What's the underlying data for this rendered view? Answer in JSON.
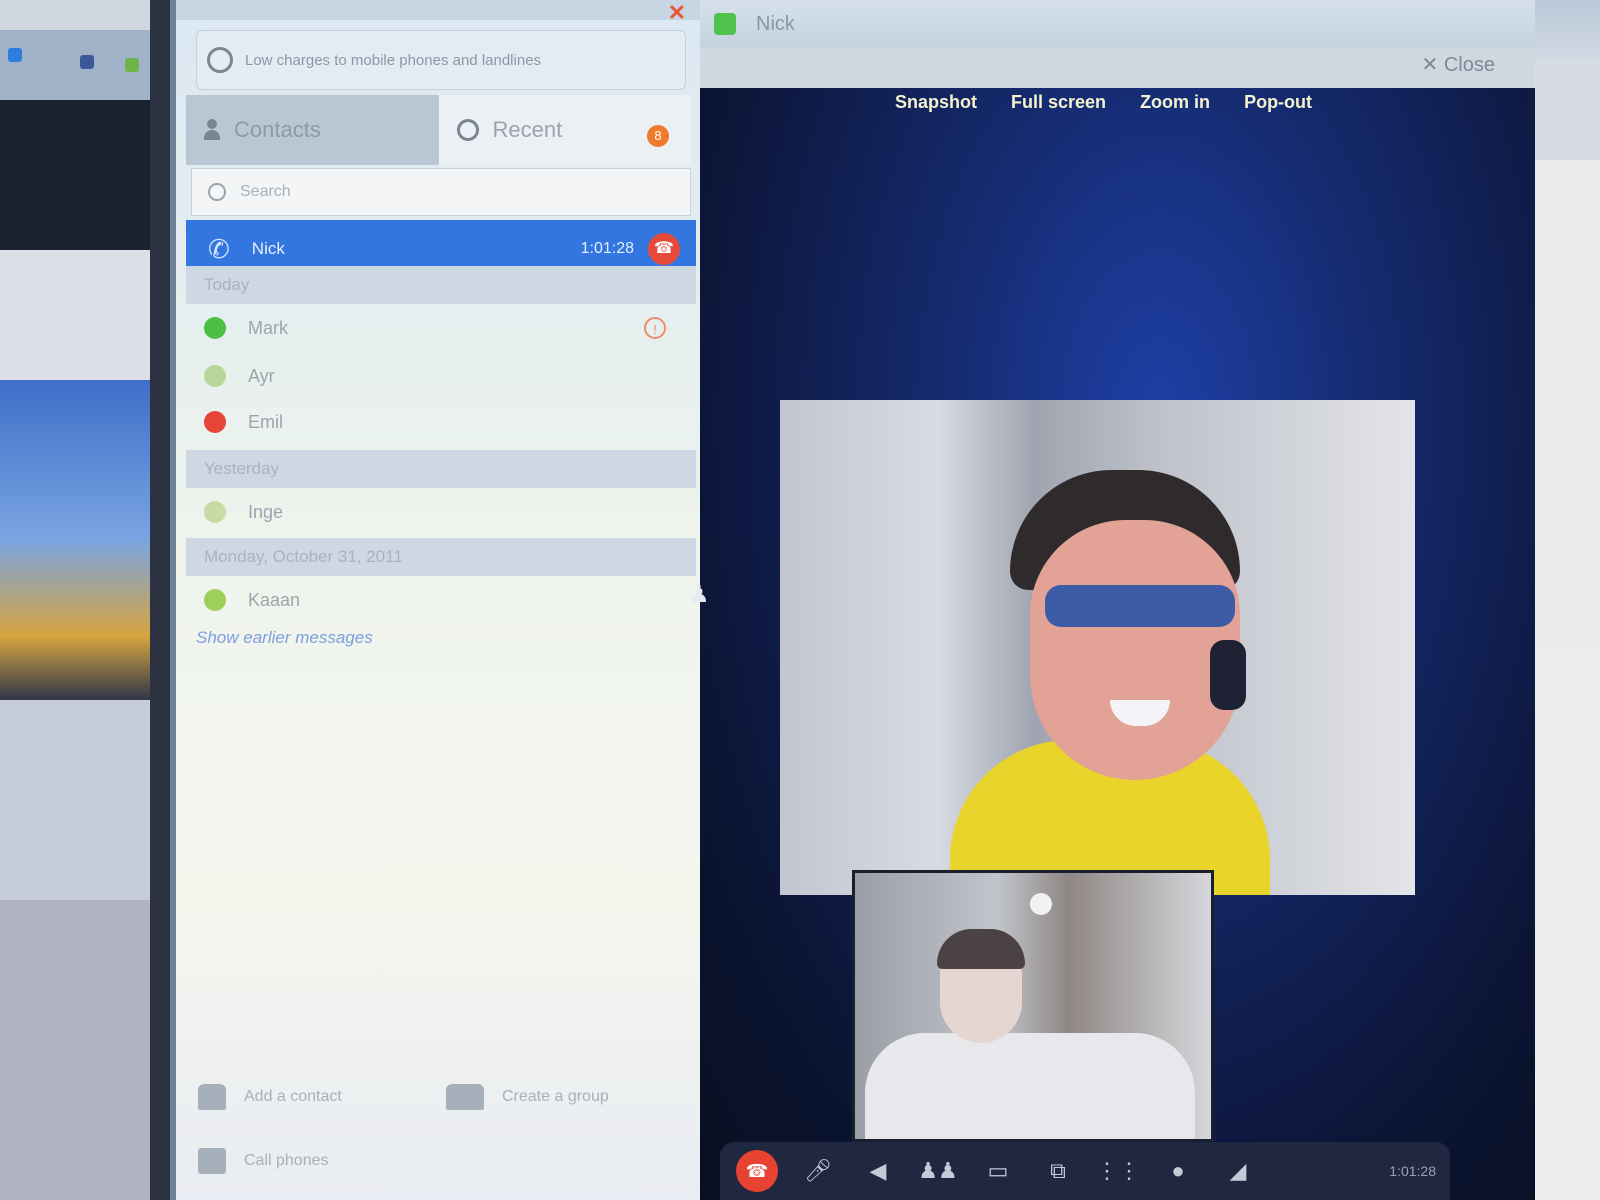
{
  "promo": {
    "text": "Low charges to mobile phones and landlines"
  },
  "tabs": {
    "contacts": "Contacts",
    "recent": "Recent",
    "recent_badge": "8"
  },
  "search": {
    "placeholder": "Search"
  },
  "active_call": {
    "name": "Nick",
    "duration": "1:01:28"
  },
  "groups": [
    {
      "label": "Today"
    },
    {
      "label": "Yesterday"
    },
    {
      "label": "Monday, October 31, 2011"
    }
  ],
  "recent_items": [
    {
      "name": "Mark",
      "status_color": "#4cbf45",
      "alert": "!"
    },
    {
      "name": "Ayr",
      "status_color": "#b9d69a"
    },
    {
      "name": "Emil",
      "status_color": "#e8453a"
    },
    {
      "name": "Inge",
      "status_color": "#c8dba6"
    },
    {
      "name": "Kaaan",
      "status_color": "#9dcf5a"
    }
  ],
  "older_link": "Show earlier messages",
  "bottom_actions": {
    "add_contact": "Add a contact",
    "create_group": "Create a group",
    "call_phones": "Call phones"
  },
  "call_window": {
    "title": "Nick",
    "close": "Close"
  },
  "video_actions": {
    "snapshot": "Snapshot",
    "full_screen": "Full screen",
    "zoom_in": "Zoom in",
    "pop_out": "Pop-out"
  },
  "toolbar": {
    "time": "1:01:28"
  },
  "colors": {
    "accent": "#3376e0",
    "hangup": "#e84a3a",
    "online": "#4cbf45"
  }
}
